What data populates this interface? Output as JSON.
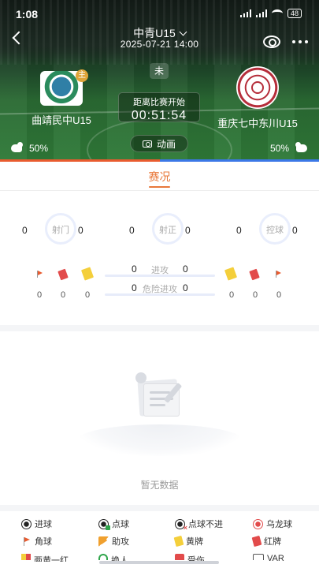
{
  "status_bar": {
    "time": "1:08",
    "battery": "48"
  },
  "header": {
    "league": "中青U15",
    "datetime": "2025-07-21 14:00",
    "match_status": "未",
    "countdown_label": "距离比赛开始",
    "countdown": "00:51:54",
    "animation_label": "动画",
    "home": {
      "name": "曲靖民中U15",
      "host_badge": "主",
      "possession": "50%"
    },
    "away": {
      "name": "重庆七中东川U15",
      "possession": "50%"
    },
    "colors": {
      "home_accent": "#e95b2f",
      "away_accent": "#3b78e7"
    }
  },
  "tabs": [
    {
      "label": "赛况",
      "active": true
    }
  ],
  "stats": {
    "rings": [
      {
        "name": "射门",
        "home": "0",
        "away": "0"
      },
      {
        "name": "射正",
        "home": "0",
        "away": "0"
      },
      {
        "name": "控球",
        "home": "0",
        "away": "0"
      }
    ],
    "home_events": {
      "corners": "0",
      "red_cards": "0",
      "yellow_cards": "0"
    },
    "away_events": {
      "yellow_cards": "0",
      "red_cards": "0",
      "corners": "0"
    },
    "bars": [
      {
        "name": "进攻",
        "home": "0",
        "away": "0"
      },
      {
        "name": "危险进攻",
        "home": "0",
        "away": "0"
      }
    ]
  },
  "empty_state": {
    "text": "暂无数据"
  },
  "legend": [
    {
      "label": "进球",
      "icon": "goal-icon"
    },
    {
      "label": "点球",
      "icon": "penalty-icon"
    },
    {
      "label": "点球不进",
      "icon": "penalty-missed-icon"
    },
    {
      "label": "乌龙球",
      "icon": "own-goal-icon"
    },
    {
      "label": "角球",
      "icon": "corner-icon"
    },
    {
      "label": "助攻",
      "icon": "assist-icon"
    },
    {
      "label": "黄牌",
      "icon": "yellow-card-icon"
    },
    {
      "label": "红牌",
      "icon": "red-card-icon"
    },
    {
      "label": "两黄一红",
      "icon": "second-yellow-icon"
    },
    {
      "label": "换人",
      "icon": "substitution-icon"
    },
    {
      "label": "受伤",
      "icon": "injury-icon"
    },
    {
      "label": "VAR",
      "icon": "var-icon"
    }
  ]
}
